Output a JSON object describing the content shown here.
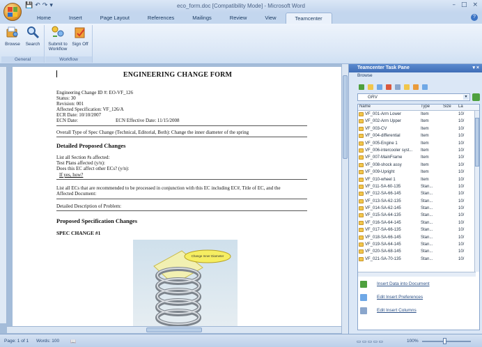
{
  "window": {
    "title": "eco_form.doc [Compatibility Mode] - Microsoft Word",
    "controls": [
      "–",
      "□",
      "×"
    ]
  },
  "qat": [
    "💾",
    "↶",
    "↷",
    "▾"
  ],
  "tabs": [
    {
      "label": "Home",
      "active": false
    },
    {
      "label": "Insert",
      "active": false
    },
    {
      "label": "Page Layout",
      "active": false
    },
    {
      "label": "References",
      "active": false
    },
    {
      "label": "Mailings",
      "active": false
    },
    {
      "label": "Review",
      "active": false
    },
    {
      "label": "View",
      "active": false
    },
    {
      "label": "Teamcenter",
      "active": true
    }
  ],
  "ribbon": {
    "groups": [
      {
        "label": "General",
        "buttons": [
          {
            "label": "Browse",
            "icon": "browse-icon"
          },
          {
            "label": "Search",
            "icon": "search-icon"
          }
        ]
      },
      {
        "label": "Workflow",
        "buttons": [
          {
            "label": "Submit to Workflow",
            "icon": "workflow-icon"
          },
          {
            "label": "Sign Off",
            "icon": "sign-off-icon"
          }
        ]
      }
    ]
  },
  "document": {
    "title": "ENGINEERING CHANGE FORM",
    "lines": {
      "ecid": "Engineering Change ID #: EO-VF_126",
      "status": "Status: 30",
      "revision": "Revision: 001",
      "affected": "Affected Specification: VF_126/A",
      "ecrdate": "ECR Date: 10/10/2007",
      "ecndate": "ECN Date:",
      "effective": "ECN Effective Date: 11/15/2008",
      "overall": "Overall Type of Spec Change (Technical, Editorial, Both): Change the inner diameter of the spring",
      "h_detailed": "Detailed Proposed Changes",
      "list_all": "List all Section #s affected:",
      "test_plans": "Test Plans affected (y/n):",
      "does_this": "Does this EC affect other ECs? (y/n):",
      "if_yes": "If yes, how?",
      "list_ecs_1": "List all ECs that are recommended to be processed in conjunction with this EC including EC#, Title of EC, and the",
      "list_ecs_2": "Affected Document:",
      "detailed_desc": "Detailed Description of Problem:",
      "h_proposed": "Proposed Specification Changes",
      "spec_change": "SPEC CHANGE  #1",
      "callout": "Change Inner Diameter"
    }
  },
  "taskpane": {
    "title": "Teamcenter Task Pane",
    "section": "Browse",
    "combo_value": "GRV",
    "columns": [
      "Name",
      "Type",
      "Size",
      "La"
    ],
    "rows": [
      {
        "name": "VF_001-Arm Lower",
        "type": "Item",
        "last": "10/"
      },
      {
        "name": "VF_002-Arm Upper",
        "type": "Item",
        "last": "10/"
      },
      {
        "name": "VF_003-CV",
        "type": "Item",
        "last": "10/"
      },
      {
        "name": "VF_004-differential",
        "type": "Item",
        "last": "10/"
      },
      {
        "name": "VF_005-Engine 1",
        "type": "Item",
        "last": "10/"
      },
      {
        "name": "VF_006-intercooler syst...",
        "type": "Item",
        "last": "10/"
      },
      {
        "name": "VF_007-MainFrame",
        "type": "Item",
        "last": "10/"
      },
      {
        "name": "VF_008-shock assy",
        "type": "Item",
        "last": "10/"
      },
      {
        "name": "VF_009-Upright",
        "type": "Item",
        "last": "10/"
      },
      {
        "name": "VF_010-wheel 1",
        "type": "Item",
        "last": "10/"
      },
      {
        "name": "VF_011-SA-60-135",
        "type": "Stan...",
        "last": "10/"
      },
      {
        "name": "VF_012-SA-66-145",
        "type": "Stan...",
        "last": "10/"
      },
      {
        "name": "VF_013-SA-62-135",
        "type": "Stan...",
        "last": "10/"
      },
      {
        "name": "VF_014-SA-62-145",
        "type": "Stan...",
        "last": "10/"
      },
      {
        "name": "VF_015-SA-64-135",
        "type": "Stan...",
        "last": "10/"
      },
      {
        "name": "VF_016-SA-64-145",
        "type": "Stan...",
        "last": "10/"
      },
      {
        "name": "VF_017-SA-66-135",
        "type": "Stan...",
        "last": "10/"
      },
      {
        "name": "VF_018-SA-66-145",
        "type": "Stan...",
        "last": "10/"
      },
      {
        "name": "VF_019-SA-64-145",
        "type": "Stan...",
        "last": "10/"
      },
      {
        "name": "VF_020-SA-68-145",
        "type": "Stan...",
        "last": "10/"
      },
      {
        "name": "VF_021-SA-70-135",
        "type": "Stan...",
        "last": "10/"
      }
    ],
    "actions": [
      {
        "label": "Insert Data into Document",
        "icon": "insert-data-icon"
      },
      {
        "label": "Edit Insert Preferences",
        "icon": "preferences-icon"
      },
      {
        "label": "Edit Insert Columns",
        "icon": "columns-icon"
      }
    ]
  },
  "statusbar": {
    "page": "Page: 1 of 1",
    "words": "Words: 100",
    "zoom": "100%"
  },
  "colors": {
    "ribbon": "#dbe7f6",
    "accent": "#3f6db6",
    "folder": "#f1c64b"
  }
}
